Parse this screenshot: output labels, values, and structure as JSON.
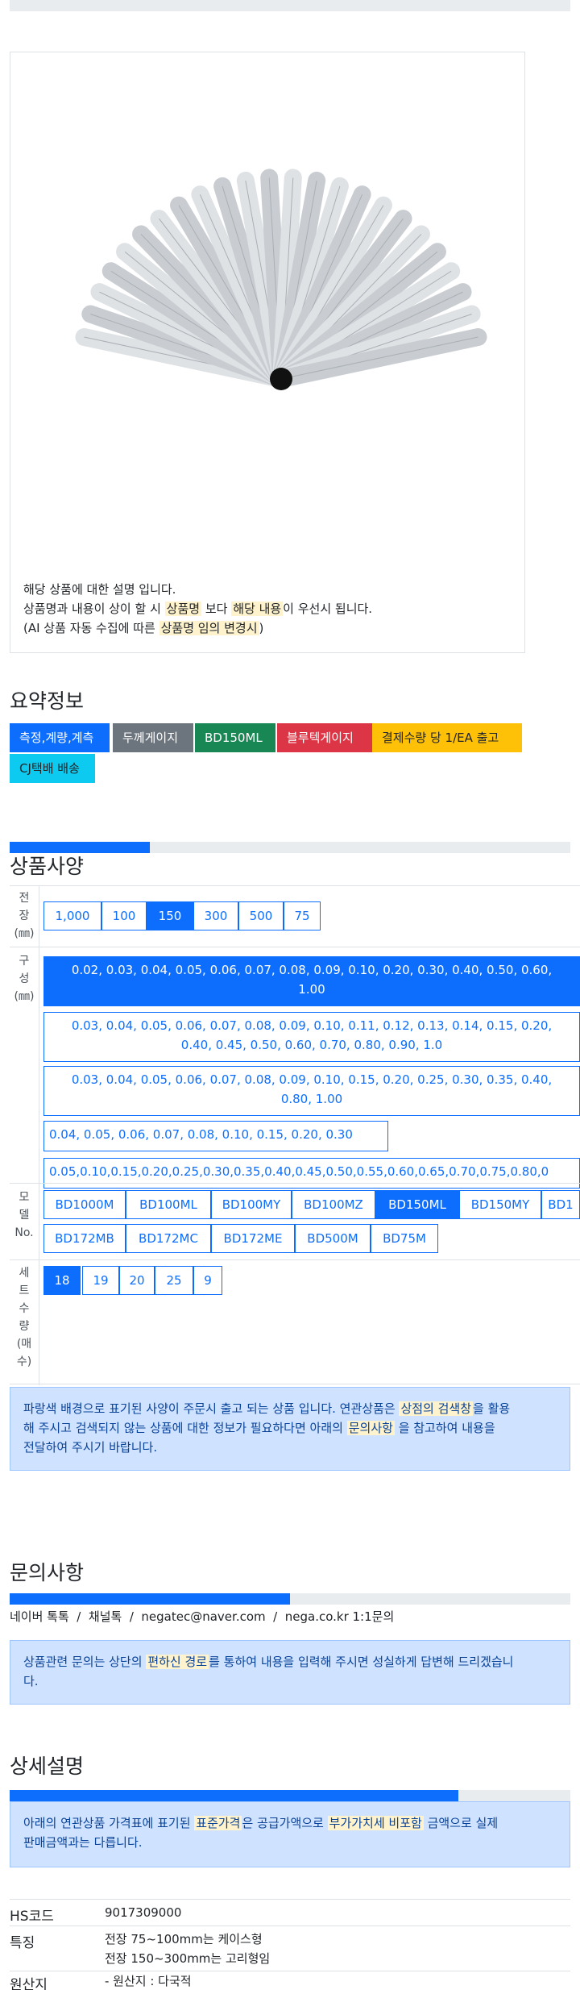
{
  "description": {
    "line1": "해당 상품에 대한 설명 입니다.",
    "line2_pre": "상품명과 내용이 상이 할 시 ",
    "line2_mark1": "상품명",
    "line2_mid": " 보다 ",
    "line2_mark2": "해당 내용",
    "line2_post": "이 우선시 됩니다.",
    "line3_pre": "(AI 상품 자동 수집에 따른 ",
    "line3_mark": "상품명 임의 변경시",
    "line3_post": ")"
  },
  "summary": {
    "title": "요약정보",
    "badges": [
      {
        "label": "측정,계량,계측",
        "color": "#0d6efd",
        "text": "#ffffff"
      },
      {
        "label": "두께게이지",
        "color": "#6c757d",
        "text": "#ffffff"
      },
      {
        "label": "BD150ML",
        "color": "#198754",
        "text": "#ffffff"
      },
      {
        "label": "블루텍게이지",
        "color": "#dc3545",
        "text": "#ffffff"
      },
      {
        "label": "결제수량 당 1/EA 출고",
        "color": "#ffc107",
        "text": "#212529"
      },
      {
        "label": "CJ택배 배송",
        "color": "#0dcaf0",
        "text": "#212529"
      }
    ]
  },
  "specs": {
    "title": "상품사양",
    "length_label": [
      "전",
      "장",
      "(㎜)"
    ],
    "lengths": [
      "1,000",
      "100",
      "150",
      "300",
      "500",
      "75"
    ],
    "length_selected": "150",
    "composition_label": [
      "구",
      "성",
      "(㎜)"
    ],
    "compositions": [
      {
        "line1": "0.02, 0.03, 0.04, 0.05, 0.06, 0.07, 0.08, 0.09, 0.10, 0.20, 0.30, 0.40, 0.50, 0.60,",
        "line2": "1.00",
        "selected": true
      },
      {
        "line1": "0.03, 0.04, 0.05, 0.06, 0.07, 0.08, 0.09, 0.10, 0.11, 0.12, 0.13, 0.14, 0.15, 0.20,",
        "line2": "0.40, 0.45, 0.50, 0.60, 0.70, 0.80, 0.90, 1.0",
        "selected": false
      },
      {
        "line1": "0.03, 0.04, 0.05, 0.06, 0.07, 0.08, 0.09, 0.10, 0.15, 0.20, 0.25, 0.30, 0.35, 0.40,",
        "line2": "0.80, 1.00",
        "selected": false
      },
      {
        "line1": "0.04, 0.05, 0.06, 0.07, 0.08, 0.10, 0.15, 0.20, 0.30",
        "line2": "",
        "selected": false
      },
      {
        "line1": "0.05,0.10,0.15,0.20,0.25,0.30,0.35,0.40,0.45,0.50,0.55,0.60,0.65,0.70,0.75,0.80,0",
        "line2": "",
        "selected": false
      }
    ],
    "model_label": [
      "모",
      "델",
      "No."
    ],
    "models_row1": [
      "BD1000M",
      "BD100ML",
      "BD100MY",
      "BD100MZ",
      "BD150ML",
      "BD150MY",
      "BD1"
    ],
    "models_row2": [
      "BD172MB",
      "BD172MC",
      "BD172ME",
      "BD500M",
      "BD75M"
    ],
    "model_selected": "BD150ML",
    "set_label": [
      "세",
      "트",
      "수",
      "량",
      "(매",
      "수)"
    ],
    "sets": [
      "18",
      "19",
      "20",
      "25",
      "9"
    ],
    "set_selected": "18"
  },
  "notice1": {
    "pre": "파랑색 배경으로 표기된 사양이 주문시 출고 되는 상품 입니다. 연관상품은 ",
    "mark1": "상점의 검색창",
    "mid": "을 활용",
    "line2_pre": "해 주시고 검색되지 않는 상품에 대한 정보가 필요하다면 아래의 ",
    "mark2": "문의사항",
    "line2_post": " 을 참고하여 내용을",
    "line3": "전달하여 주시기 바랍니다."
  },
  "inquiry": {
    "title": "문의사항",
    "channels": "네이버 톡톡  /  채널톡  /  negatec@naver.com  /  nega.co.kr 1:1문의",
    "notice_pre": "상품관련 문의는 상단의 ",
    "notice_mark": "편하신 경로",
    "notice_post": "를 통하여 내용을 입력해 주시면 성실하게 답변해 드리겠습니",
    "notice_line2": "다."
  },
  "detail": {
    "title": "상세설명",
    "notice_pre": "아래의 연관상품 가격표에 표기된 ",
    "notice_mark1": "표준가격",
    "notice_mid": "은 공급가액으로 ",
    "notice_mark2": "부가가치세 비포함",
    "notice_post": " 금액으로 실제",
    "notice_line2": "판매금액과는 다릅니다.",
    "rows": [
      {
        "key": "HS코드",
        "values": [
          "9017309000"
        ]
      },
      {
        "key": "특징",
        "values": [
          "전장 75~100mm는 케이스형",
          "전장 150~300mm는 고리형임"
        ]
      },
      {
        "key": "원산지",
        "values": [
          "- 원산지 : 다국적"
        ]
      }
    ]
  },
  "progress": {
    "specs": 0.25,
    "inquiry": 0.5,
    "detail": 0.8
  }
}
